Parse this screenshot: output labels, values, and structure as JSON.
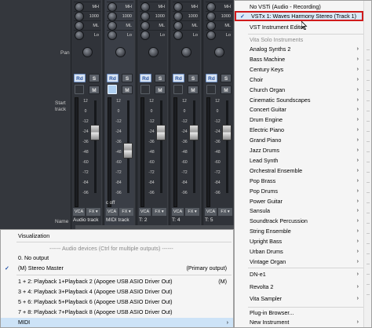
{
  "mixer": {
    "pan_label": "Pan",
    "start_track_label": "Start track",
    "name_label": "Name",
    "eq_values": [
      [
        "MH",
        "1000",
        "ML",
        "Lo"
      ],
      [
        "MH",
        "1000",
        "ML",
        "Lo"
      ],
      [
        "MH",
        "1000",
        "ML",
        "Lo"
      ],
      [
        "MH",
        "1000",
        "ML",
        "Lo"
      ],
      [
        "MH",
        "1000",
        "ML",
        "Lo"
      ]
    ],
    "rd_label": "Rd",
    "s_label": "S",
    "m_label": "M",
    "vca_label": "VCA",
    "fx_label": "FX",
    "scale_labels": [
      "12",
      "0",
      "-12",
      "-24",
      "-36",
      "-48",
      "-60",
      "-72",
      "-84",
      "-96"
    ],
    "strips": [
      {
        "name": "Audio track",
        "sub": "",
        "fader_pos": 0.32,
        "monitor_on": false
      },
      {
        "name": "MIDI track",
        "sub": "c off",
        "fader_pos": 0.55,
        "monitor_on": true
      },
      {
        "name": "T: 2",
        "sub": "",
        "fader_pos": 0.32,
        "monitor_on": false
      },
      {
        "name": "T: 4",
        "sub": "",
        "fader_pos": 0.32,
        "monitor_on": false
      },
      {
        "name": "T: 5",
        "sub": "",
        "fader_pos": 0.32,
        "monitor_on": false
      }
    ]
  },
  "output_menu": {
    "visualization": "Visualization",
    "audio_devices_header": "------ Audio devices (Ctrl for multiple outputs) ------",
    "no_output": "0. No output",
    "stereo_master": "(M) Stereo Master",
    "stereo_master_right": "(Primary output)",
    "outputs": [
      {
        "label": "1 + 2:  Playback 1+Playback 2 (Apogee USB ASIO Driver Out)",
        "right": "(M)"
      },
      {
        "label": "3 + 4:  Playback 3+Playback 4 (Apogee USB ASIO Driver Out)",
        "right": ""
      },
      {
        "label": "5 + 6:  Playback 5+Playback 6 (Apogee USB ASIO Driver Out)",
        "right": ""
      },
      {
        "label": "7 + 8:  Playback 7+Playback 8 (Apogee USB ASIO Driver Out)",
        "right": ""
      }
    ],
    "midi": "MIDI"
  },
  "instrument_menu": {
    "no_vsti": "No VSTi (Audio - Recording)",
    "selected_vsti": "VSTx   1: Waves Harmony Stereo (Track 1)",
    "vst_editor": "VST Instrument Editor",
    "vita_header": "Vita Solo Instruments",
    "instruments": [
      "Analog Synths 2",
      "Bass Machine",
      "Century Keys",
      "Choir",
      "Church Organ",
      "Cinematic Soundscapes",
      "Concert Guitar",
      "Drum Engine",
      "Electric Piano",
      "Grand Piano",
      "Jazz Drums",
      "Lead Synth",
      "Orchestral Ensemble",
      "Pop Brass",
      "Pop Drums",
      "Power Guitar",
      "Sansula",
      "Soundtrack Percussion",
      "String Ensemble",
      "Upright Bass",
      "Urban Drums",
      "Vintage Organ"
    ],
    "more": [
      "DN-e1",
      "Revolta 2",
      "Vita Sampler"
    ],
    "plugin_browser": "Plug-in Browser...",
    "new_instrument": "New Instrument",
    "submenu_arrow": "›"
  }
}
